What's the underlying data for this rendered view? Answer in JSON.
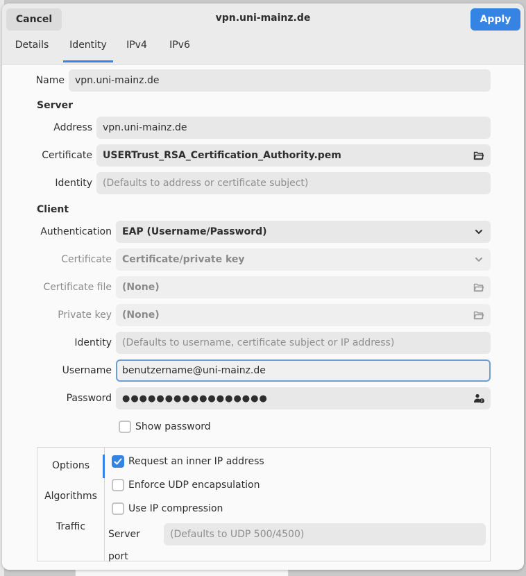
{
  "header": {
    "cancel_label": "Cancel",
    "title": "vpn.uni-mainz.de",
    "apply_label": "Apply"
  },
  "tabs": [
    {
      "label": "Details",
      "active": false
    },
    {
      "label": "Identity",
      "active": true
    },
    {
      "label": "IPv4",
      "active": false
    },
    {
      "label": "IPv6",
      "active": false
    }
  ],
  "name": {
    "label": "Name",
    "value": "vpn.uni-mainz.de"
  },
  "server": {
    "heading": "Server",
    "address_label": "Address",
    "address_value": "vpn.uni-mainz.de",
    "certificate_label": "Certificate",
    "certificate_value": "USERTrust_RSA_Certification_Authority.pem",
    "identity_label": "Identity",
    "identity_placeholder": "(Defaults to address or certificate subject)"
  },
  "client": {
    "heading": "Client",
    "authentication_label": "Authentication",
    "authentication_value": "EAP (Username/Password)",
    "certificate_label": "Certificate",
    "certificate_value": "Certificate/private key",
    "certificate_file_label": "Certificate file",
    "certificate_file_value": "(None)",
    "private_key_label": "Private key",
    "private_key_value": "(None)",
    "identity_label": "Identity",
    "identity_placeholder": "(Defaults to username, certificate subject or IP address)",
    "username_label": "Username",
    "username_value": "benutzername@uni-mainz.de",
    "password_label": "Password",
    "password_value": "●●●●●●●●●●●●●●●●●",
    "show_password_label": "Show password",
    "show_password_checked": false
  },
  "options": {
    "sidebar": [
      {
        "label": "Options",
        "active": true
      },
      {
        "label": "Algorithms",
        "active": false
      },
      {
        "label": "Traffic",
        "active": false
      }
    ],
    "request_inner_ip_label": "Request an inner IP address",
    "request_inner_ip_checked": true,
    "enforce_udp_label": "Enforce UDP encapsulation",
    "enforce_udp_checked": false,
    "ip_compression_label": "Use IP compression",
    "ip_compression_checked": false,
    "server_port_label": "Server port",
    "server_port_placeholder": "(Defaults to UDP 500/4500)"
  },
  "colors": {
    "accent": "#3584e4",
    "header_bg": "#ebebeb",
    "field_bg": "#e8e8e8"
  }
}
